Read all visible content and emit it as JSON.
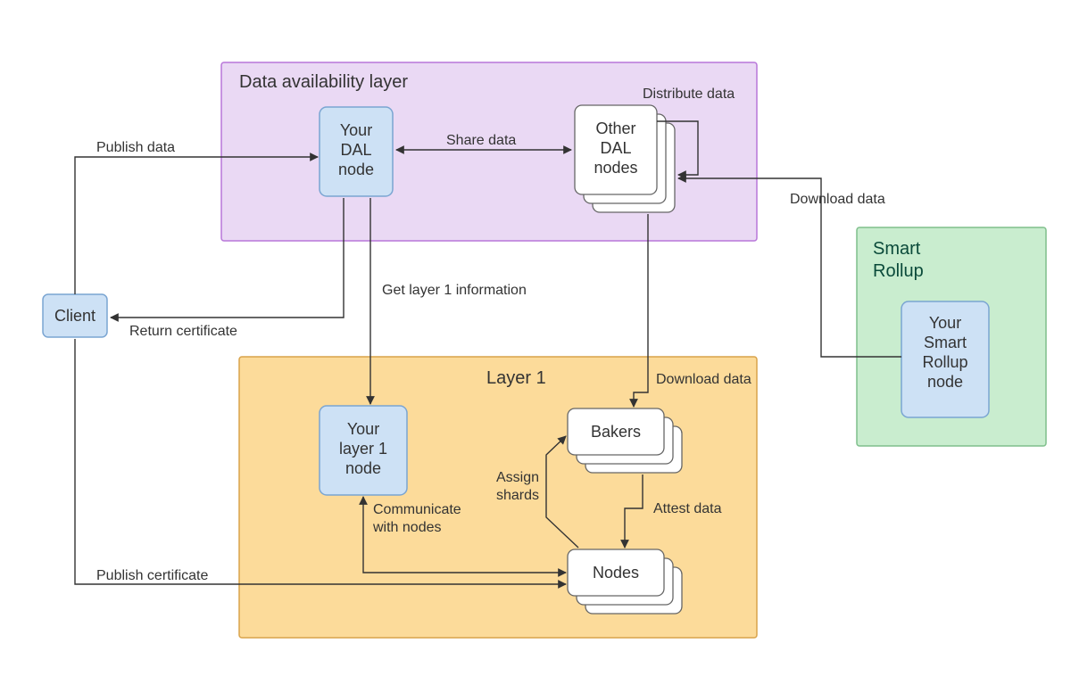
{
  "colors": {
    "dal_fill": "#ead9f4",
    "dal_stroke": "#b877d9",
    "layer1_fill": "#fcdb9a",
    "layer1_stroke": "#d9a34a",
    "sr_fill": "#c9edcf",
    "sr_stroke": "#7fbf8c",
    "blue_fill": "#cde1f5",
    "blue_stroke": "#7aa5d2",
    "white_fill": "#ffffff",
    "white_stroke": "#666666",
    "arrow": "#333333"
  },
  "containers": {
    "dal": {
      "title": "Data availability layer"
    },
    "layer1": {
      "title": "Layer 1"
    },
    "smart_rollup": {
      "title_l1": "Smart",
      "title_l2": "Rollup"
    }
  },
  "nodes": {
    "client": "Client",
    "your_dal": {
      "l1": "Your",
      "l2": "DAL",
      "l3": "node"
    },
    "other_dal": {
      "l1": "Other",
      "l2": "DAL",
      "l3": "nodes"
    },
    "your_l1": {
      "l1": "Your",
      "l2": "layer 1",
      "l3": "node"
    },
    "bakers": "Bakers",
    "nodes": "Nodes",
    "sr_node": {
      "l1": "Your",
      "l2": "Smart",
      "l3": "Rollup",
      "l4": "node"
    }
  },
  "edges": {
    "publish_data": "Publish data",
    "share_data": "Share data",
    "distribute_data": "Distribute data",
    "return_certificate": "Return certificate",
    "get_l1_info": "Get layer 1 information",
    "download_data_inner": "Download data",
    "download_data_sr": "Download data",
    "assign_shards_l1": "Assign",
    "assign_shards_l2": "shards",
    "attest_data": "Attest data",
    "communicate_l1": "Communicate",
    "communicate_l2": "with nodes",
    "publish_certificate": "Publish certificate"
  }
}
